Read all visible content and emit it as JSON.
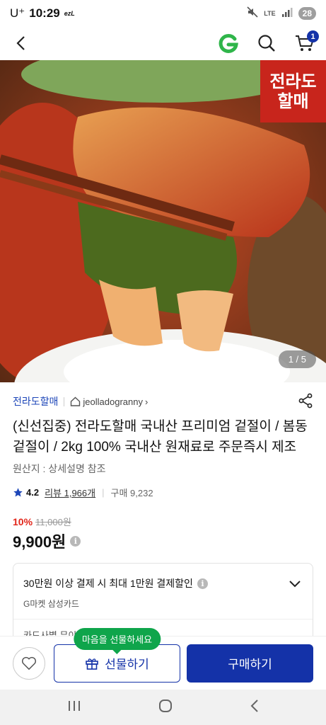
{
  "status_bar": {
    "carrier": "U⁺",
    "time": "10:29",
    "ezl": "ezL",
    "lte": "LTE",
    "battery": "28"
  },
  "top_nav": {
    "cart_count": "1",
    "g_color": "#2fb54a"
  },
  "hero": {
    "brand_stamp_line1": "전라도",
    "brand_stamp_line2": "할매",
    "page_indicator": "1 / 5"
  },
  "seller": {
    "name": "전라도할매",
    "store": "jeolladogranny",
    "store_chevron": "›"
  },
  "product": {
    "title": "(신선집중) 전라도할매 국내산 프리미엄 겉절이 / 봄동 겉절이 / 2kg 100% 국내산 원재료로 주문즉시 제조",
    "origin": "원산지 : 상세설명 참조",
    "rating": "4.2",
    "reviews": "리뷰 1,966개",
    "purchases": "구매 9,232",
    "discount": "10%",
    "original_price": "11,000원",
    "price": "9,900원"
  },
  "benefit": {
    "text": "30만원 이상 결제 시 최대 1만원 결제할인",
    "card": "G마켓 삼성카드",
    "more": "카드사별 무이자할부"
  },
  "actions": {
    "gift_tooltip": "마음을 선물하세요",
    "gift_label": "선물하기",
    "buy_label": "구매하기"
  },
  "colors": {
    "brand_blue": "#1432a8",
    "discount_red": "#e2261a",
    "tooltip_green": "#0fa54b",
    "stamp_red": "#c8251c"
  }
}
